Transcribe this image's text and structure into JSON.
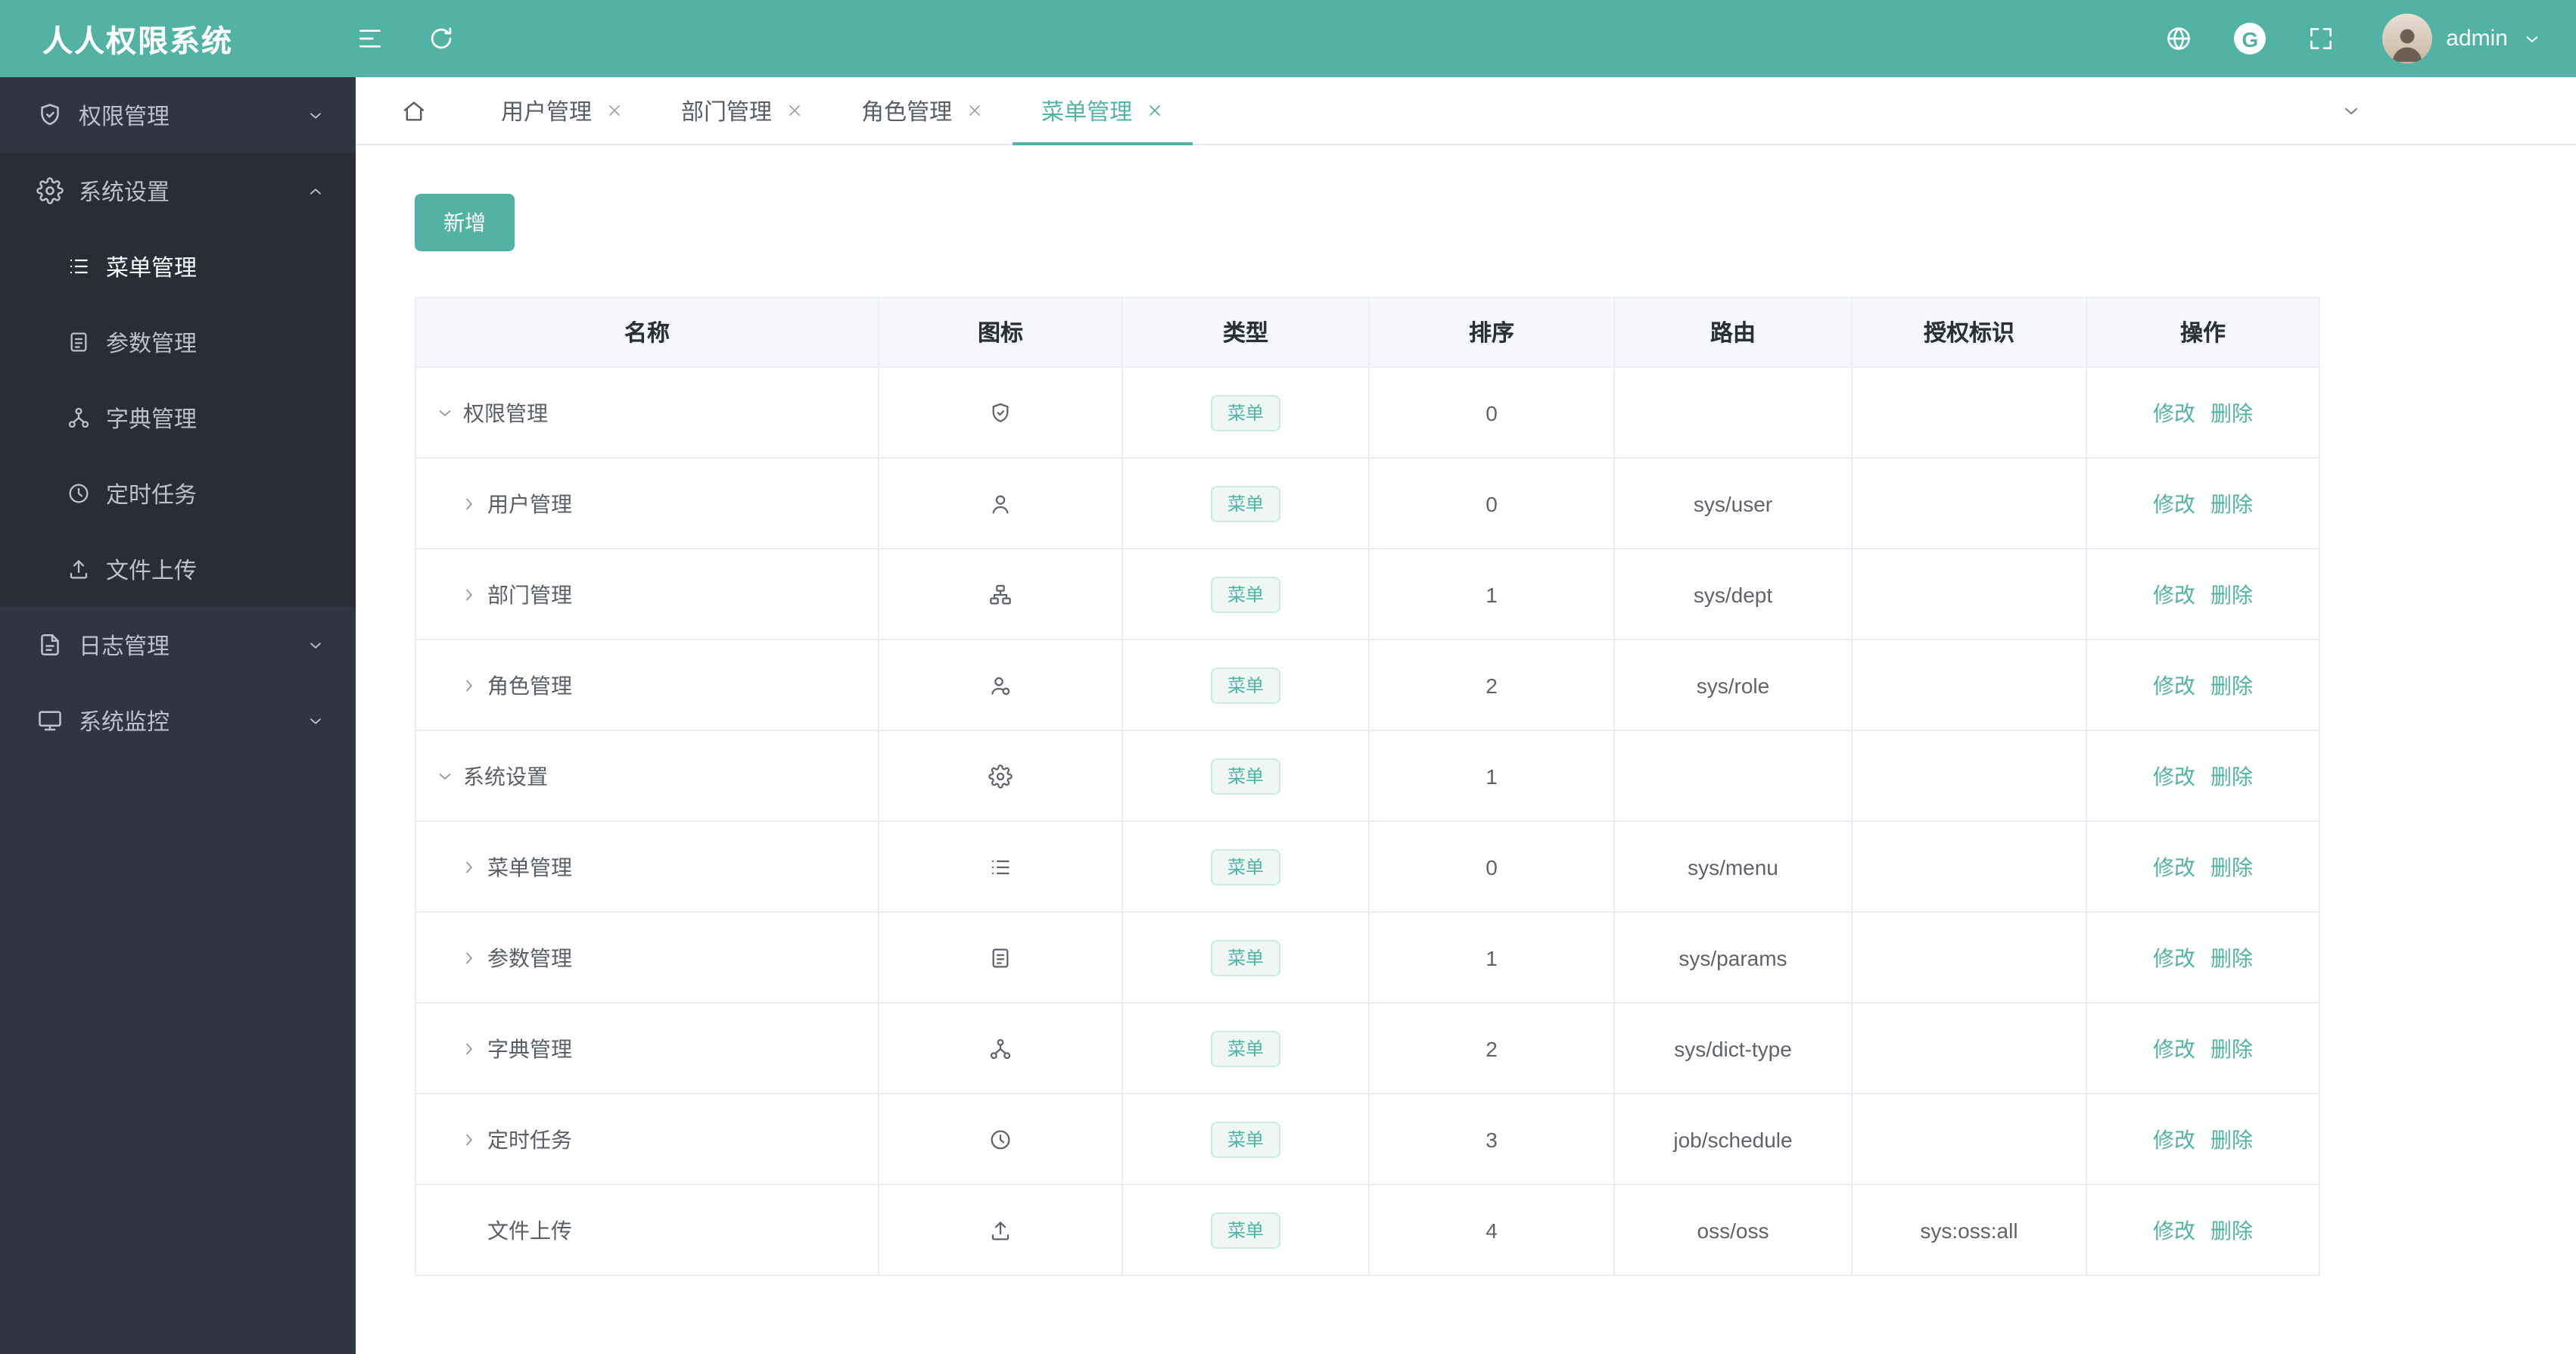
{
  "app": {
    "title": "人人权限系统"
  },
  "header": {
    "username": "admin",
    "gitee_letter": "G",
    "icons": [
      "menu-fold-icon",
      "refresh-icon",
      "globe-icon",
      "gitee-icon",
      "fullscreen-icon",
      "avatar",
      "chevron-down-icon"
    ]
  },
  "sidebar": {
    "items": [
      {
        "label": "权限管理",
        "icon": "shield-icon",
        "expanded": false
      },
      {
        "label": "系统设置",
        "icon": "gear-icon",
        "expanded": true,
        "children": [
          {
            "label": "菜单管理",
            "icon": "list-icon",
            "active": true
          },
          {
            "label": "参数管理",
            "icon": "document-icon",
            "active": false
          },
          {
            "label": "字典管理",
            "icon": "tree-icon",
            "active": false
          },
          {
            "label": "定时任务",
            "icon": "clock-icon",
            "active": false
          },
          {
            "label": "文件上传",
            "icon": "upload-icon",
            "active": false
          }
        ]
      },
      {
        "label": "日志管理",
        "icon": "log-icon",
        "expanded": false
      },
      {
        "label": "系统监控",
        "icon": "monitor-icon",
        "expanded": false
      }
    ]
  },
  "tabs": [
    {
      "label": "用户管理",
      "active": false
    },
    {
      "label": "部门管理",
      "active": false
    },
    {
      "label": "角色管理",
      "active": false
    },
    {
      "label": "菜单管理",
      "active": true
    }
  ],
  "toolbar": {
    "add_label": "新增"
  },
  "table": {
    "headers": [
      "名称",
      "图标",
      "类型",
      "排序",
      "路由",
      "授权标识",
      "操作"
    ],
    "actions": {
      "edit": "修改",
      "delete": "删除"
    },
    "rows": [
      {
        "name": "权限管理",
        "icon": "shield-icon",
        "level": 0,
        "arrow": "down",
        "type": "菜单",
        "order": "0",
        "route": "",
        "perm": ""
      },
      {
        "name": "用户管理",
        "icon": "user-icon",
        "level": 1,
        "arrow": "right",
        "type": "菜单",
        "order": "0",
        "route": "sys/user",
        "perm": ""
      },
      {
        "name": "部门管理",
        "icon": "org-icon",
        "level": 1,
        "arrow": "right",
        "type": "菜单",
        "order": "1",
        "route": "sys/dept",
        "perm": ""
      },
      {
        "name": "角色管理",
        "icon": "role-icon",
        "level": 1,
        "arrow": "right",
        "type": "菜单",
        "order": "2",
        "route": "sys/role",
        "perm": ""
      },
      {
        "name": "系统设置",
        "icon": "gear-icon",
        "level": 0,
        "arrow": "down",
        "type": "菜单",
        "order": "1",
        "route": "",
        "perm": ""
      },
      {
        "name": "菜单管理",
        "icon": "list-icon",
        "level": 1,
        "arrow": "right",
        "type": "菜单",
        "order": "0",
        "route": "sys/menu",
        "perm": ""
      },
      {
        "name": "参数管理",
        "icon": "document-icon",
        "level": 1,
        "arrow": "right",
        "type": "菜单",
        "order": "1",
        "route": "sys/params",
        "perm": ""
      },
      {
        "name": "字典管理",
        "icon": "tree-icon",
        "level": 1,
        "arrow": "right",
        "type": "菜单",
        "order": "2",
        "route": "sys/dict-type",
        "perm": ""
      },
      {
        "name": "定时任务",
        "icon": "clock-icon",
        "level": 1,
        "arrow": "right",
        "type": "菜单",
        "order": "3",
        "route": "job/schedule",
        "perm": ""
      },
      {
        "name": "文件上传",
        "icon": "upload-icon",
        "level": 1,
        "arrow": "none",
        "type": "菜单",
        "order": "4",
        "route": "oss/oss",
        "perm": "sys:oss:all"
      }
    ]
  },
  "colors": {
    "primary": "#52b3a5",
    "sidebar_bg": "#2f3542",
    "sidebar_submenu_bg": "#282d37",
    "badge_bg": "#edf8f4",
    "badge_border": "#cbe9e1",
    "table_border": "#ebeef5",
    "table_header_bg": "#f6f7fa"
  }
}
